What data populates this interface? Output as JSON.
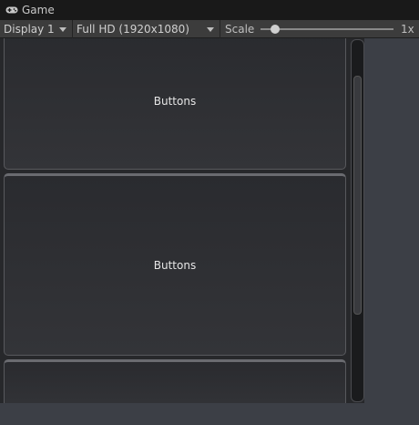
{
  "window": {
    "tab_label": "Game",
    "tab_icon": "gamepad-icon"
  },
  "toolbar": {
    "display": {
      "selected": "Display 1"
    },
    "resolution": {
      "selected": "Full HD (1920x1080)"
    },
    "scale": {
      "label": "Scale",
      "value_label": "1x",
      "slider_fraction": 0.11
    }
  },
  "content": {
    "buttons": [
      {
        "label": "Buttons"
      },
      {
        "label": "Buttons"
      },
      {
        "label": ""
      }
    ]
  }
}
